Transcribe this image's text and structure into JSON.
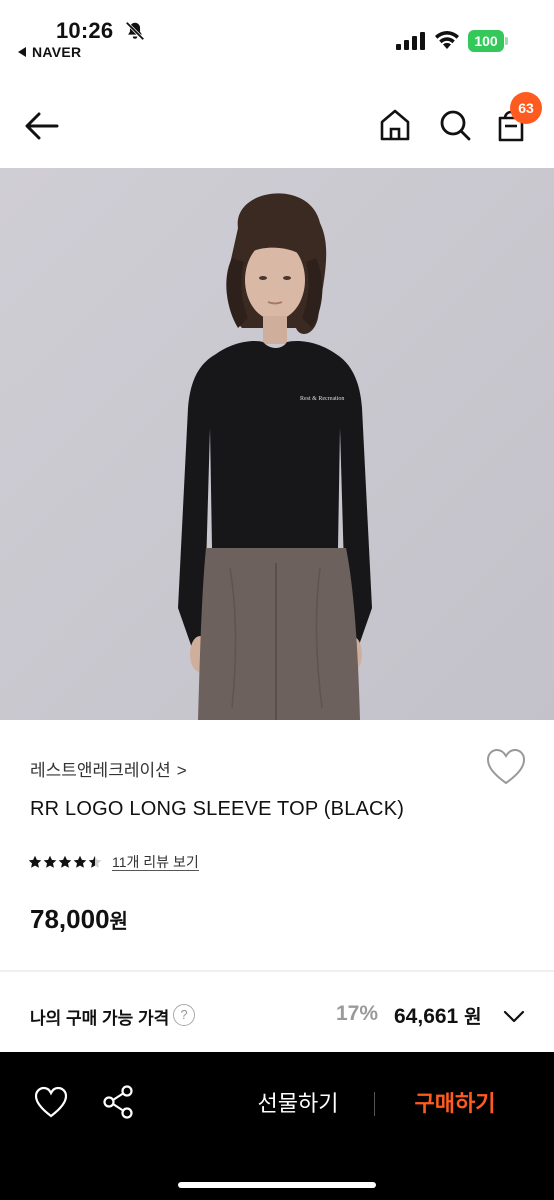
{
  "status": {
    "time": "10:26",
    "back_app": "NAVER",
    "battery": "100"
  },
  "nav": {
    "cart_count": "63"
  },
  "product": {
    "brand": "레스트앤레크레이션",
    "brand_chevron": ">",
    "title": "RR LOGO LONG SLEEVE TOP (BLACK)",
    "rating": 4.5,
    "review_link": "11개 리뷰 보기",
    "price": "78,000",
    "price_unit": "원"
  },
  "my_price": {
    "label": "나의 구매 가능 가격",
    "help_symbol": "?",
    "discount": "17%",
    "price": "64,661",
    "unit": "원"
  },
  "actions": {
    "gift_label": "선물하기",
    "buy_label": "구매하기"
  },
  "colors": {
    "accent": "#ff5a1f",
    "battery": "#34c759"
  }
}
